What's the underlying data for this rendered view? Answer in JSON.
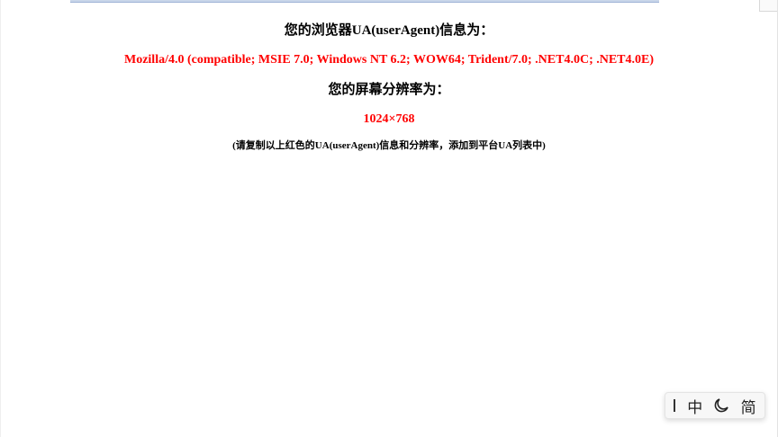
{
  "page": {
    "ua_heading": "您的浏览器UA(userAgent)信息为：",
    "ua_value": "Mozilla/4.0 (compatible; MSIE 7.0; Windows NT 6.2; WOW64; Trident/7.0; .NET4.0C; .NET4.0E)",
    "resolution_heading": "您的屏幕分辨率为：",
    "resolution_value": "1024×768",
    "note": "(请复制以上红色的UA(userAgent)信息和分辨率，添加到平台UA列表中)"
  },
  "colors": {
    "highlight": "#ff0000",
    "text": "#000000"
  },
  "ime_toolbar": {
    "language_label": "中",
    "width_mode_icon": "half-moon-icon",
    "script_label": "简"
  }
}
